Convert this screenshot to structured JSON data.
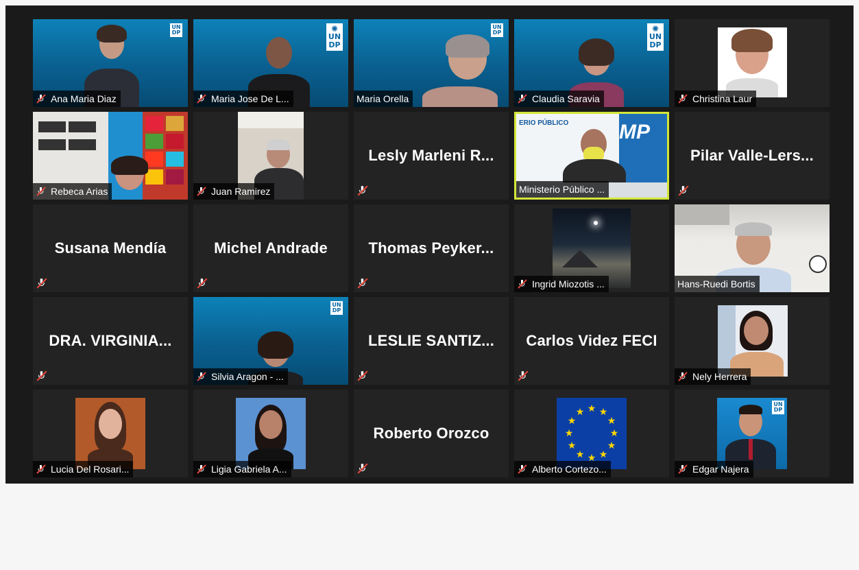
{
  "participants": [
    {
      "name": "Ana Maria Diaz",
      "muted": true
    },
    {
      "name": "Maria Jose De L...",
      "muted": true
    },
    {
      "name": "Maria Orella",
      "muted": false
    },
    {
      "name": "Claudia Saravia",
      "muted": true
    },
    {
      "name": "Christina Laur",
      "muted": true
    },
    {
      "name": "Rebeca Arias",
      "muted": true
    },
    {
      "name": "Juan Ramirez",
      "muted": true
    },
    {
      "name": "Lesly  Marleni R...",
      "muted": true,
      "video": false
    },
    {
      "name": "Ministerio Público ...",
      "muted": false,
      "active_speaker": true
    },
    {
      "name": "Pilar  Valle-Lers...",
      "muted": true,
      "video": false
    },
    {
      "name": "Susana Mendía",
      "muted": true,
      "video": false
    },
    {
      "name": "Michel Andrade",
      "muted": true,
      "video": false
    },
    {
      "name": "Thomas  Peyker...",
      "muted": true,
      "video": false
    },
    {
      "name": "Ingrid Miozotis ...",
      "muted": true
    },
    {
      "name": "Hans-Ruedi Bortis",
      "muted": false
    },
    {
      "name": "DRA.  VIRGINIA...",
      "muted": true,
      "video": false
    },
    {
      "name": "Silvia Aragon - ...",
      "muted": true
    },
    {
      "name": "LESLIE  SANTIZ...",
      "muted": true,
      "video": false
    },
    {
      "name": "Carlos Videz FECI",
      "muted": true,
      "video": false
    },
    {
      "name": "Nely Herrera",
      "muted": true
    },
    {
      "name": "Lucia Del Rosari...",
      "muted": true
    },
    {
      "name": "Ligia Gabriela A...",
      "muted": true
    },
    {
      "name": "Roberto Orozco",
      "muted": true,
      "video": false
    },
    {
      "name": "Alberto Cortezo...",
      "muted": true
    },
    {
      "name": "Edgar Najera",
      "muted": true
    }
  ],
  "logos": {
    "undp_top": "UN",
    "undp_bottom": "DP",
    "mp_banner": "ERIO PÚBLICO",
    "mp_logo": "MP"
  },
  "colors": {
    "active_speaker_border": "#d3e63a",
    "muted_icon": "#e0463c",
    "tile_bg": "#232323",
    "window_bg": "#1a1a1a"
  },
  "icons": {
    "muted": "mic-muted-icon",
    "undp": "undp-logo-icon"
  }
}
